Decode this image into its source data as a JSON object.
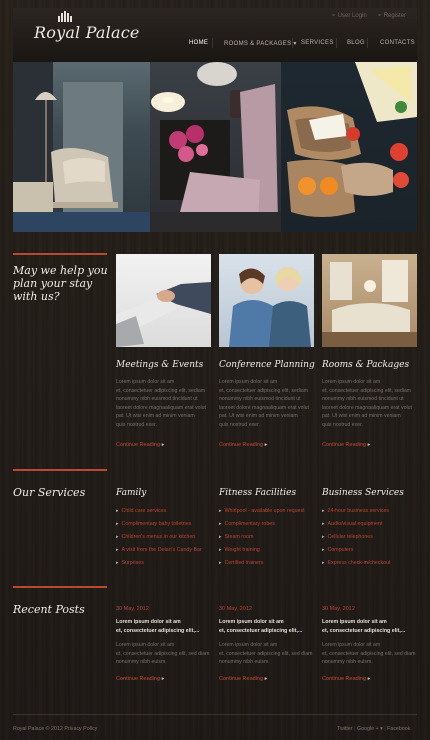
{
  "header": {
    "logo": "Royal Palace",
    "user_login": "User Login",
    "register": "Register",
    "nav": [
      {
        "label": "HOME",
        "active": true
      },
      {
        "label": "ROOMS & PACKAGES"
      },
      {
        "label": "SERVICES"
      },
      {
        "label": "BLOG"
      },
      {
        "label": "CONTACTS"
      }
    ]
  },
  "intro": {
    "title_line1": "May we help you",
    "title_line2": "plan your stay",
    "title_line3": "with us?"
  },
  "features": [
    {
      "title": "Meetings & Events",
      "text": [
        "Lorem ipsum dolor sit am",
        "et, consectetuer adipiscing elit, sediam",
        "nonummy nibh euismod tincidunt ut",
        "laoreet dolore magnaaliquam erat volut",
        "pat. Ut wisi enim ad minim veniam",
        "quis nostrud exer."
      ],
      "link": "Continue Reading"
    },
    {
      "title": "Conference Planning",
      "text": [
        "Lorem ipsum dolor sit am",
        "et, consectetuer adipiscing elit, sediam",
        "nonummy nibh euismod tincidunt ut",
        "laoreet dolore magnaaliquam erat volut",
        "pat. Ut wisi enim ad minim veniam",
        "quis nostrud exer."
      ],
      "link": "Continue Reading"
    },
    {
      "title": "Rooms & Packages",
      "text": [
        "Lorem ipsum dolor sit am",
        "et, consectetuer adipiscing elit, sediam",
        "nonummy nibh euismod tincidunt ut",
        "laoreet dolore magnaaliquam erat volut",
        "pat. Ut wisi enim ad minim veniam",
        "quis nostrud exer."
      ],
      "link": "Continue Reading"
    }
  ],
  "services": {
    "title": "Our Services",
    "columns": [
      {
        "title": "Family",
        "items": [
          "Child care services",
          "Complimentary baby toiletries",
          "Children's menus in our kitchen",
          "A visit from the Delan's Candy Bar",
          "Surprises"
        ]
      },
      {
        "title": "Fitness Facilities",
        "items": [
          "Whirlpool - available upon request",
          "Complimentary robes",
          "Steam room",
          "Weight training",
          "Certified trainers"
        ]
      },
      {
        "title": "Business Services",
        "items": [
          "24-hour business services",
          "Audio/visual equipment",
          "Cellular telephones",
          "Computers",
          "Express check-in/checkout"
        ]
      }
    ]
  },
  "posts": {
    "title": "Recent Posts",
    "items": [
      {
        "date": "30 May, 2012",
        "title": [
          "Lorem ipsum dolor sit am",
          "et, consectetuer adipiscing elit,..."
        ],
        "text": [
          "Lorem ipsum dolor sit am",
          "et, consectetuer adipiscing elit, sed diam",
          "nonummy nibh euism."
        ],
        "link": "Continue Reading"
      },
      {
        "date": "30 May, 2012",
        "title": [
          "Lorem ipsum dolor sit am",
          "et, consectetuer adipiscing elit,..."
        ],
        "text": [
          "Lorem ipsum dolor sit am",
          "et, consectetuer adipiscing elit, sed diam",
          "nonummy nibh euism."
        ],
        "link": "Continue Reading"
      },
      {
        "date": "30 May, 2012",
        "title": [
          "Lorem ipsum dolor sit am",
          "et, consectetuer adipiscing elit,..."
        ],
        "text": [
          "Lorem ipsum dolor sit am",
          "et, consectetuer adipiscing elit, sed diam",
          "nonummy nibh euism."
        ],
        "link": "Continue Reading"
      }
    ]
  },
  "footer": {
    "copyright": "Royal Palace © 2012",
    "privacy": "Privacy Policy",
    "links": [
      "Twitter",
      "Google +",
      "Facebook"
    ]
  },
  "colors": {
    "accent": "#b8452f",
    "background": "#1f1a17",
    "text": "#77706a"
  }
}
